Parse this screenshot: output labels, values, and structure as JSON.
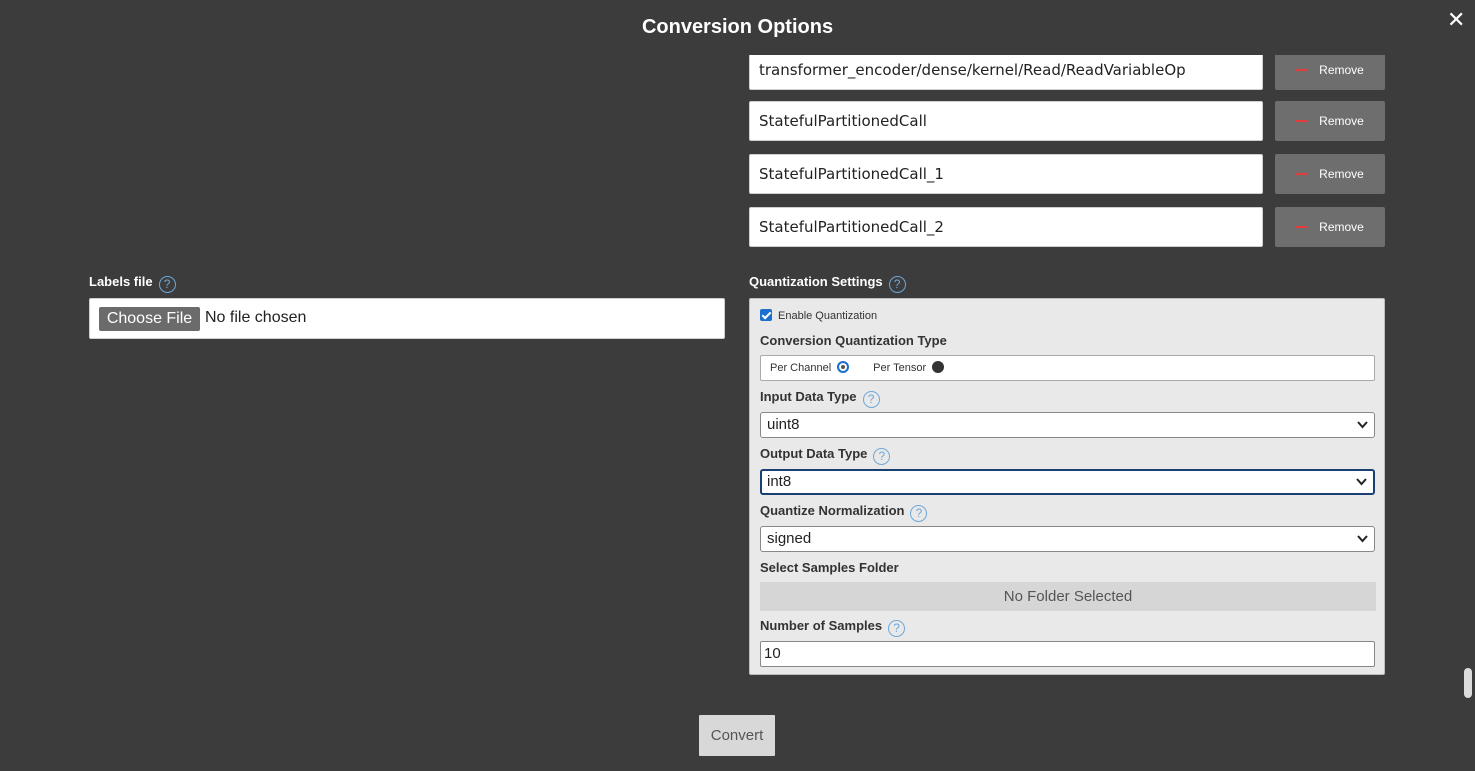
{
  "dialog": {
    "title": "Conversion Options",
    "close_glyph": "✕"
  },
  "output_nodes": [
    {
      "value": "transformer_encoder/dense/kernel/Read/ReadVariableOp",
      "remove_label": "Remove"
    },
    {
      "value": "StatefulPartitionedCall",
      "remove_label": "Remove"
    },
    {
      "value": "StatefulPartitionedCall_1",
      "remove_label": "Remove"
    },
    {
      "value": "StatefulPartitionedCall_2",
      "remove_label": "Remove"
    }
  ],
  "labels_file": {
    "label": "Labels file",
    "button_label": "Choose File",
    "status": "No file chosen"
  },
  "quantization": {
    "label": "Quantization Settings",
    "enable_label": "Enable Quantization",
    "enabled": true,
    "type_label": "Conversion Quantization Type",
    "per_channel_label": "Per Channel",
    "per_tensor_label": "Per Tensor",
    "selected_type": "Per Channel",
    "input_type_label": "Input Data Type",
    "input_type_value": "uint8",
    "output_type_label": "Output Data Type",
    "output_type_value": "int8",
    "normalization_label": "Quantize Normalization",
    "normalization_value": "signed",
    "samples_folder_label": "Select Samples Folder",
    "samples_folder_value": "No Folder Selected",
    "num_samples_label": "Number of Samples",
    "num_samples_value": "10"
  },
  "help_glyph": "?",
  "convert_label": "Convert",
  "colors": {
    "modal_bg": "#3c3c3c",
    "help_blue": "#6fa7d8",
    "remove_minus": "#e23b3b",
    "focus_border": "#1a3f73"
  }
}
